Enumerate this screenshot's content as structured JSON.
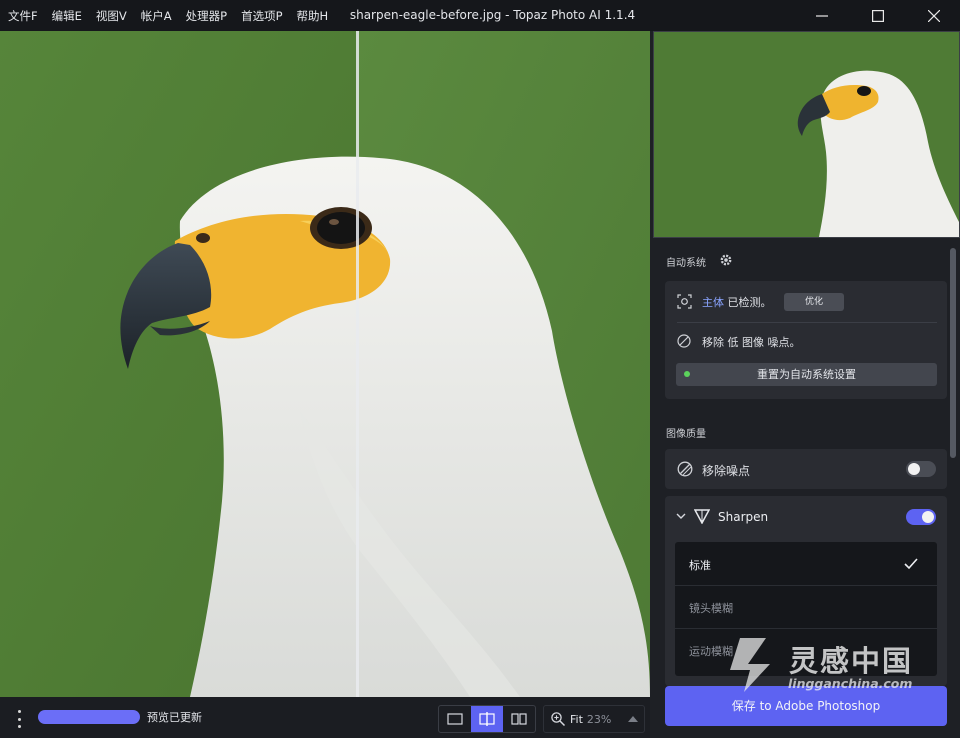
{
  "menu": [
    "文件F",
    "编辑E",
    "视图V",
    "帐户A",
    "处理器P",
    "首选项P",
    "帮助H"
  ],
  "window_title": "sharpen-eagle-before.jpg - Topaz Photo AI 1.1.4",
  "icons": {
    "minimize": "minimize-icon",
    "maximize": "maximize-icon",
    "close": "close-icon",
    "gear": "gear-icon",
    "subject": "subject-detect-icon",
    "noise": "noise-icon",
    "sharpen": "sharpen-icon",
    "check": "check-icon",
    "zoom": "zoom-icon"
  },
  "auto_system": {
    "title": "自动系统",
    "subject_highlight": "主体",
    "subject_text": "已检测。",
    "optimize_button": "优化",
    "noise_text": "移除 低 图像 噪点。",
    "reset_button": "重置为自动系统设置"
  },
  "image_quality": {
    "title": "图像质量",
    "denoise_label": "移除噪点",
    "denoise_enabled": false,
    "sharpen_label": "Sharpen",
    "sharpen_enabled": true,
    "sharpen_options": [
      {
        "label": "标准",
        "selected": true
      },
      {
        "label": "镜头模糊",
        "selected": false
      },
      {
        "label": "运动模糊",
        "selected": false
      }
    ]
  },
  "bottom": {
    "preview_status": "预览已更新",
    "zoom_label": "Fit",
    "zoom_value": "23%"
  },
  "save_button": "保存 to Adobe Photoshop",
  "watermark": {
    "cn": "灵感中国",
    "en": "lingganchina.com"
  },
  "colors": {
    "accent": "#5d63f2",
    "link_blue": "#8aa4ff",
    "background": "#1b1d22",
    "card": "#2a2c32"
  }
}
